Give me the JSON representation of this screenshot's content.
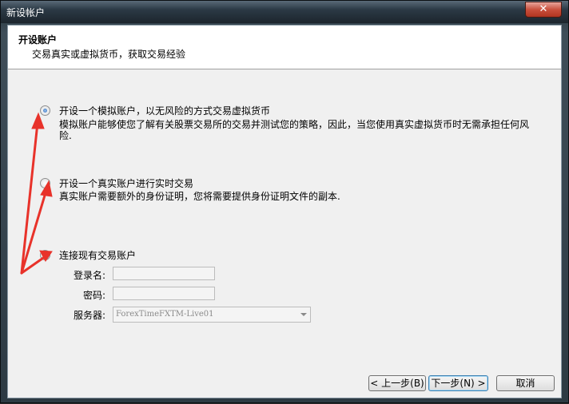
{
  "window": {
    "title": "新设帐户",
    "close_label": "✕"
  },
  "header": {
    "title": "开设账户",
    "subtitle": "交易真实或虚拟货币，获取交易经验"
  },
  "options": [
    {
      "label": "开设一个模拟账户，以无风险的方式交易虚拟货币",
      "description": "模拟账户能够使您了解有关股票交易所的交易并测试您的策略，因此，当您使用真实虚拟货币时无需承担任何风险.",
      "checked": true
    },
    {
      "label": "开设一个真实账户进行实时交易",
      "description": "真实账户需要额外的身份证明，您将需要提供身份证明文件的副本.",
      "checked": false
    },
    {
      "label": "连接现有交易账户",
      "description": "",
      "checked": false
    }
  ],
  "login_form": {
    "login_label": "登录名:",
    "login_value": "",
    "password_label": "密码:",
    "password_value": "",
    "server_label": "服务器:",
    "server_value": "ForexTimeFXTM-Live01"
  },
  "buttons": {
    "back": "< 上一步(B)",
    "next": "下一步(N) >",
    "cancel": "取消"
  },
  "colors": {
    "annotation_arrow": "#e8322a",
    "radio_selected": "#2a66b8"
  }
}
